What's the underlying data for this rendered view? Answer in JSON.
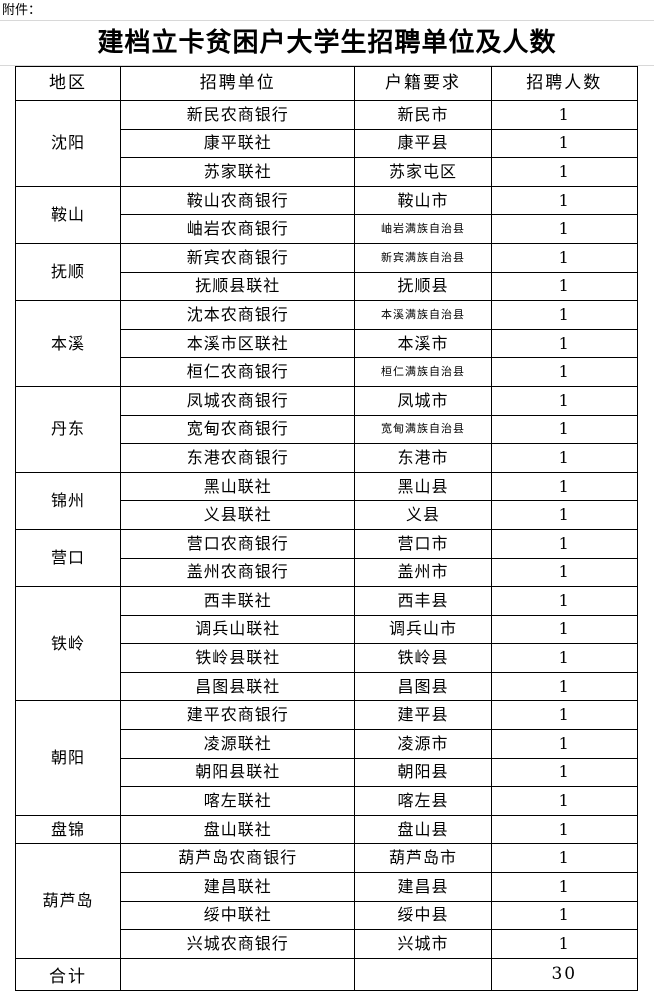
{
  "document": {
    "attachment_label": "附件：",
    "title": "建档立卡贫困户大学生招聘单位及人数"
  },
  "table": {
    "headers": {
      "region": "地区",
      "unit": "招聘单位",
      "household": "户籍要求",
      "count": "招聘人数"
    },
    "groups": [
      {
        "region": "沈阳",
        "rows": [
          {
            "unit": "新民农商银行",
            "household": "新民市",
            "household_small": false,
            "count": "1"
          },
          {
            "unit": "康平联社",
            "household": "康平县",
            "household_small": false,
            "count": "1"
          },
          {
            "unit": "苏家联社",
            "household": "苏家屯区",
            "household_small": false,
            "count": "1"
          }
        ]
      },
      {
        "region": "鞍山",
        "rows": [
          {
            "unit": "鞍山农商银行",
            "household": "鞍山市",
            "household_small": false,
            "count": "1"
          },
          {
            "unit": "岫岩农商银行",
            "household": "岫岩满族自治县",
            "household_small": true,
            "count": "1"
          }
        ]
      },
      {
        "region": "抚顺",
        "rows": [
          {
            "unit": "新宾农商银行",
            "household": "新宾满族自治县",
            "household_small": true,
            "count": "1"
          },
          {
            "unit": "抚顺县联社",
            "household": "抚顺县",
            "household_small": false,
            "count": "1"
          }
        ]
      },
      {
        "region": "本溪",
        "rows": [
          {
            "unit": "沈本农商银行",
            "household": "本溪满族自治县",
            "household_small": true,
            "count": "1"
          },
          {
            "unit": "本溪市区联社",
            "household": "本溪市",
            "household_small": false,
            "count": "1"
          },
          {
            "unit": "桓仁农商银行",
            "household": "桓仁满族自治县",
            "household_small": true,
            "count": "1"
          }
        ]
      },
      {
        "region": "丹东",
        "rows": [
          {
            "unit": "凤城农商银行",
            "household": "凤城市",
            "household_small": false,
            "count": "1"
          },
          {
            "unit": "宽甸农商银行",
            "household": "宽甸满族自治县",
            "household_small": true,
            "count": "1"
          },
          {
            "unit": "东港农商银行",
            "household": "东港市",
            "household_small": false,
            "count": "1"
          }
        ]
      },
      {
        "region": "锦州",
        "rows": [
          {
            "unit": "黑山联社",
            "household": "黑山县",
            "household_small": false,
            "count": "1"
          },
          {
            "unit": "义县联社",
            "household": "义县",
            "household_small": false,
            "count": "1"
          }
        ]
      },
      {
        "region": "营口",
        "rows": [
          {
            "unit": "营口农商银行",
            "household": "营口市",
            "household_small": false,
            "count": "1"
          },
          {
            "unit": "盖州农商银行",
            "household": "盖州市",
            "household_small": false,
            "count": "1"
          }
        ]
      },
      {
        "region": "铁岭",
        "rows": [
          {
            "unit": "西丰联社",
            "household": "西丰县",
            "household_small": false,
            "count": "1"
          },
          {
            "unit": "调兵山联社",
            "household": "调兵山市",
            "household_small": false,
            "count": "1"
          },
          {
            "unit": "铁岭县联社",
            "household": "铁岭县",
            "household_small": false,
            "count": "1"
          },
          {
            "unit": "昌图县联社",
            "household": "昌图县",
            "household_small": false,
            "count": "1"
          }
        ]
      },
      {
        "region": "朝阳",
        "rows": [
          {
            "unit": "建平农商银行",
            "household": "建平县",
            "household_small": false,
            "count": "1"
          },
          {
            "unit": "凌源联社",
            "household": "凌源市",
            "household_small": false,
            "count": "1"
          },
          {
            "unit": "朝阳县联社",
            "household": "朝阳县",
            "household_small": false,
            "count": "1"
          },
          {
            "unit": "喀左联社",
            "household": "喀左县",
            "household_small": false,
            "count": "1"
          }
        ]
      },
      {
        "region": "盘锦",
        "rows": [
          {
            "unit": "盘山联社",
            "household": "盘山县",
            "household_small": false,
            "count": "1"
          }
        ]
      },
      {
        "region": "葫芦岛",
        "rows": [
          {
            "unit": "葫芦岛农商银行",
            "household": "葫芦岛市",
            "household_small": false,
            "count": "1"
          },
          {
            "unit": "建昌联社",
            "household": "建昌县",
            "household_small": false,
            "count": "1"
          },
          {
            "unit": "绥中联社",
            "household": "绥中县",
            "household_small": false,
            "count": "1"
          },
          {
            "unit": "兴城农商银行",
            "household": "兴城市",
            "household_small": false,
            "count": "1"
          }
        ]
      }
    ],
    "total": {
      "label": "合计",
      "unit": "",
      "household": "",
      "count": "30"
    }
  }
}
